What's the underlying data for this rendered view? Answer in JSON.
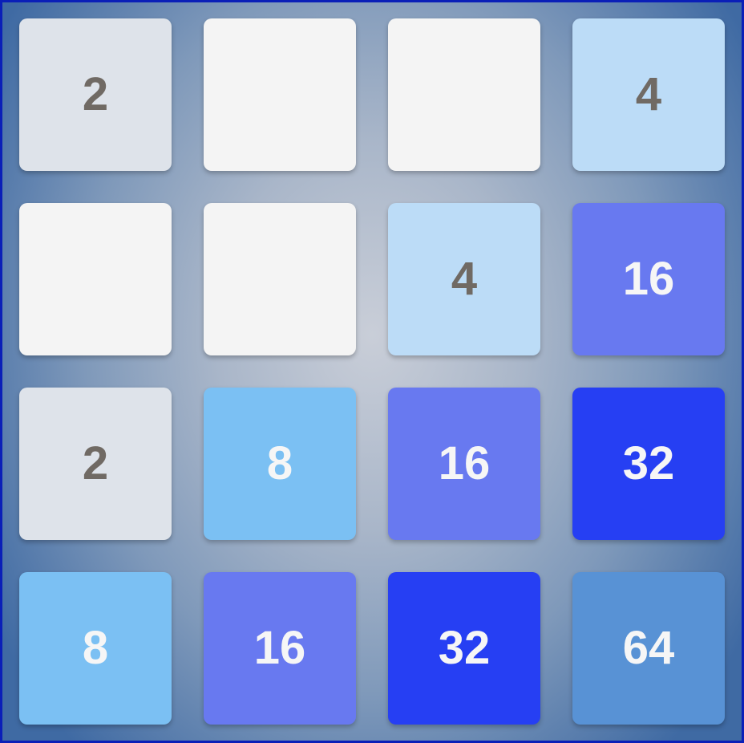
{
  "board": {
    "size": 4,
    "tiles": [
      [
        2,
        0,
        0,
        4
      ],
      [
        0,
        0,
        4,
        16
      ],
      [
        2,
        8,
        16,
        32
      ],
      [
        8,
        16,
        32,
        64
      ]
    ]
  },
  "colors": {
    "border": "#0a1fb8",
    "tile_empty": "#f4f4f4",
    "tile_2": "#dee3ea",
    "tile_4": "#bcdcf7",
    "tile_8": "#7bc0f3",
    "tile_16": "#6879f0",
    "tile_32": "#263ff3",
    "tile_64": "#5892d5",
    "text_dark": "#706a64",
    "text_light": "#f6f6f6"
  }
}
